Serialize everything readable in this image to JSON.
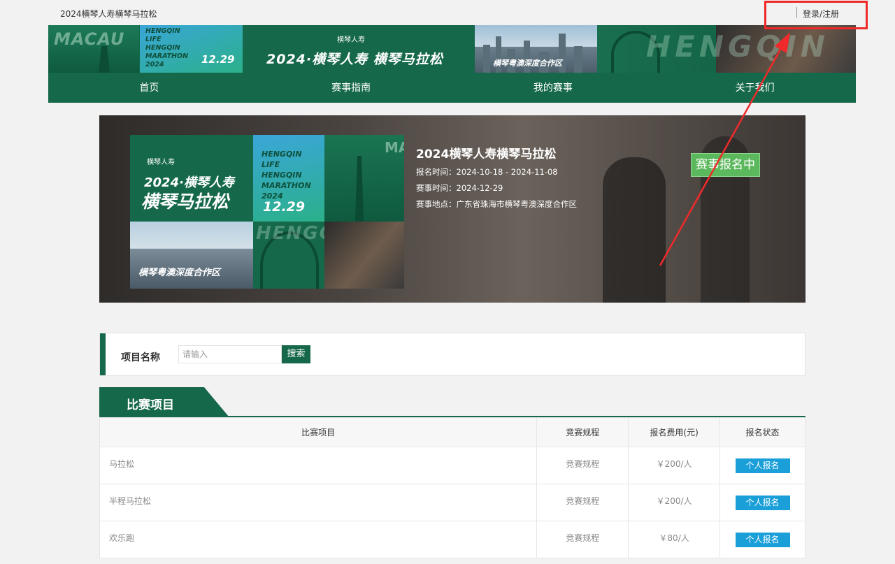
{
  "header": {
    "site_title": "2024横琴人寿横琴马拉松",
    "login_label": "登录/注册"
  },
  "banner": {
    "macau_word": "MACAU",
    "blue_lines": [
      "HENGQIN",
      "LIFE",
      "HENGQIN",
      "MARATHON",
      "2024"
    ],
    "date": "12.29",
    "logos": "横琴人寿",
    "headline": "2024·横琴人寿 横琴马拉松",
    "city_caption": "横琴粤澳深度合作区",
    "right_word": "HENGQIN"
  },
  "nav": {
    "items": [
      "首页",
      "赛事指南",
      "我的赛事",
      "关于我们"
    ]
  },
  "event": {
    "poster": {
      "logos": "横琴人寿",
      "line1": "2024·横琴人寿",
      "line2": "横琴马拉松",
      "blue_lines": [
        "HENGQIN",
        "LIFE",
        "HENGQIN",
        "MARATHON",
        "2024"
      ],
      "date": "12.29",
      "macau_word": "MACAU",
      "city_caption": "横琴粤澳深度合作区",
      "arch_word": "HENGQIN"
    },
    "title": "2024横琴人寿横琴马拉松",
    "reg_time_label": "报名时间：",
    "reg_time_value": "2024-10-18 - 2024-11-08",
    "race_time_label": "赛事时间：",
    "race_time_value": "2024-12-29",
    "location_label": "赛事地点：",
    "location_value": "广东省珠海市横琴粤澳深度合作区",
    "status": "赛事报名中"
  },
  "search": {
    "label": "项目名称",
    "placeholder": "请输入",
    "value": "",
    "button": "搜索"
  },
  "section": {
    "title": "比赛项目"
  },
  "table": {
    "columns": [
      "比赛项目",
      "竞赛规程",
      "报名费用(元)",
      "报名状态"
    ],
    "rows": [
      {
        "name": "马拉松",
        "rule": "竞赛规程",
        "fee": "￥200/人",
        "action": "个人报名"
      },
      {
        "name": "半程马拉松",
        "rule": "竞赛规程",
        "fee": "￥200/人",
        "action": "个人报名"
      },
      {
        "name": "欢乐跑",
        "rule": "竞赛规程",
        "fee": "￥80/人",
        "action": "个人报名"
      }
    ]
  },
  "colors": {
    "brand_green": "#15684a",
    "status_green": "#5cb85c",
    "register_blue": "#1a9fd9",
    "annotation_red": "#f02a2a"
  }
}
